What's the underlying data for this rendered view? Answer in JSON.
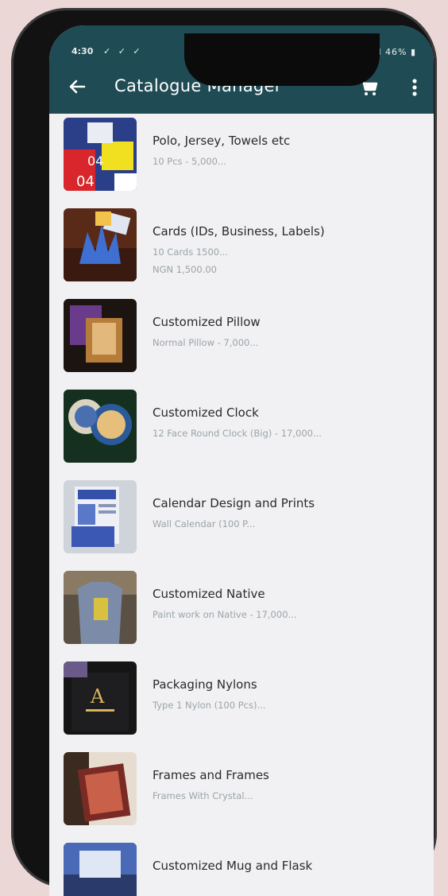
{
  "status": {
    "time": "4:30",
    "notif_icons": "✓ ✓ ✓",
    "sys": "✱ ᯤ .ıl 46% ▮"
  },
  "appbar": {
    "title": "Catalogue Manager",
    "back_icon": "arrow-left-icon",
    "cart_icon": "cart-icon",
    "more_icon": "more-vertical-icon"
  },
  "items": [
    {
      "name": "Polo, Jersey, Towels etc",
      "sub": "10 Pcs - 5,000...",
      "sub2": ""
    },
    {
      "name": "Cards (IDs, Business, Labels)",
      "sub": "10 Cards 1500...",
      "sub2": "NGN 1,500.00"
    },
    {
      "name": "Customized Pillow",
      "sub": "Normal Pillow - 7,000...",
      "sub2": ""
    },
    {
      "name": "Customized Clock",
      "sub": "12 Face Round Clock (Big) - 17,000...",
      "sub2": ""
    },
    {
      "name": "Calendar Design and Prints",
      "sub": "Wall Calendar (100 P...",
      "sub2": ""
    },
    {
      "name": "Customized Native",
      "sub": "Paint work on Native - 17,000...",
      "sub2": ""
    },
    {
      "name": "Packaging Nylons",
      "sub": "Type 1 Nylon (100 Pcs)...",
      "sub2": ""
    },
    {
      "name": "Frames and Frames",
      "sub": "Frames With Crystal...",
      "sub2": ""
    },
    {
      "name": "Customized Mug and Flask",
      "sub": "",
      "sub2": ""
    }
  ]
}
